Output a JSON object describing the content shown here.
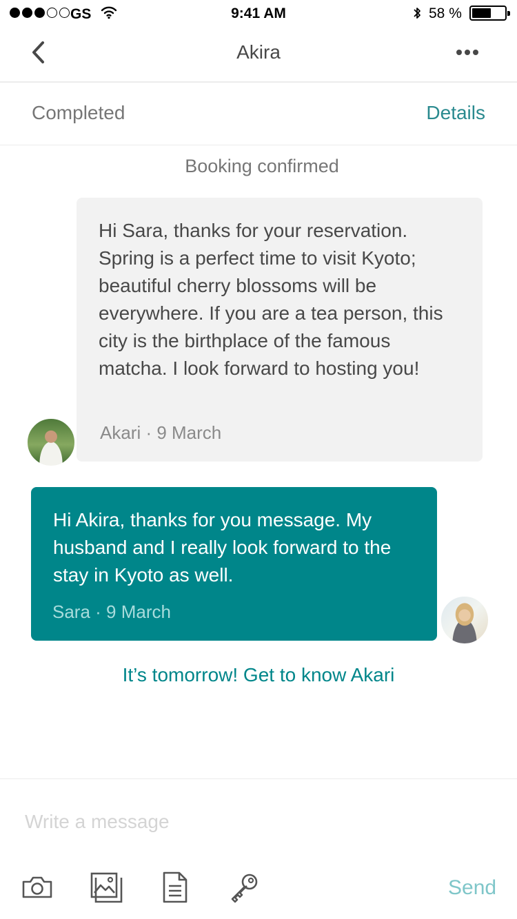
{
  "status_bar": {
    "carrier": "GS",
    "time": "9:41 AM",
    "battery_percent": "58 %",
    "battery_level": 0.58,
    "signal_bars_filled": 3,
    "signal_bars_total": 5,
    "icons": [
      "wifi-icon",
      "bluetooth-icon",
      "battery-icon"
    ]
  },
  "nav": {
    "title": "Akira",
    "back_icon": "chevron-left-icon",
    "more_icon": "ellipsis-icon"
  },
  "reservation": {
    "status": "Completed",
    "details_label": "Details"
  },
  "thread": {
    "system_message": "Booking confirmed",
    "messages": [
      {
        "author": "Akari",
        "date": "9 March",
        "meta": "Akari · 9 March",
        "text": "Hi Sara, thanks for your reservation. Spring is a perfect time to visit Kyoto; beautiful cherry blossoms will be everywhere. If you are a tea person, this city is the birthplace of the famous matcha. I look forward to hosting you!",
        "direction": "incoming"
      },
      {
        "author": "Sara",
        "date": "9 March",
        "meta": "Sara  ·  9 March",
        "text": "Hi Akira, thanks for you message. My husband and I really look forward to the stay in Kyoto as well.",
        "direction": "outgoing"
      }
    ],
    "cta": "It’s tomorrow! Get to know Akari"
  },
  "composer": {
    "placeholder": "Write a message",
    "value": "",
    "send_label": "Send",
    "tools": [
      "camera-icon",
      "photo-gallery-icon",
      "document-icon",
      "key-icon"
    ]
  },
  "colors": {
    "accent": "#00868a",
    "details_link": "#2a8a8f",
    "send_inactive": "#7fc6c9",
    "incoming_bubble": "#f2f2f2",
    "text_primary": "#484848",
    "text_secondary": "#767676"
  }
}
